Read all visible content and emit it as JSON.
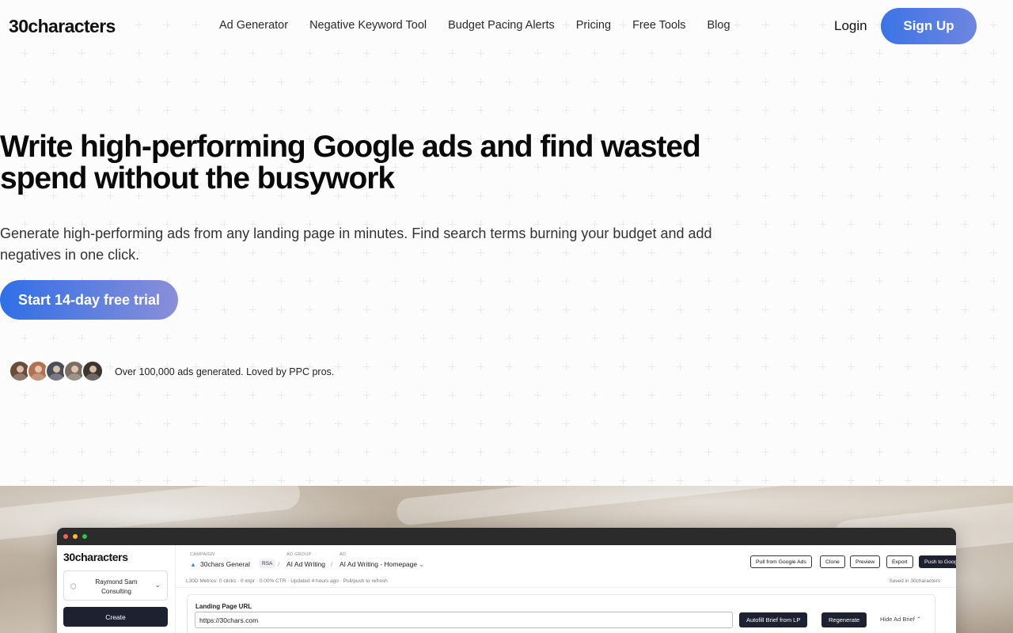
{
  "header": {
    "logo": "30characters",
    "nav": [
      "Ad Generator",
      "Negative Keyword Tool",
      "Budget Pacing Alerts",
      "Pricing",
      "Free Tools",
      "Blog"
    ],
    "login": "Login",
    "signup": "Sign Up"
  },
  "hero": {
    "title": "Write high-performing Google ads and find wasted spend without the busywork",
    "subtitle": "Generate high-performing ads from any landing page in minutes. Find search terms burning your budget and add negatives in one click.",
    "cta": "Start 14-day free trial",
    "social_proof": "Over 100,000 ads generated. Loved by PPC pros."
  },
  "avatars": [
    {
      "color": "#6b4b3a"
    },
    {
      "color": "#b07252"
    },
    {
      "color": "#4a4f57"
    },
    {
      "color": "#7b6f64"
    },
    {
      "color": "#3d3530"
    }
  ],
  "app": {
    "logo": "30characters",
    "org": "Raymond Sam Consulting",
    "create": "Create",
    "breadcrumb": {
      "campaign_label": "CAMPAIGN",
      "campaign": "30chars General",
      "badge": "RSA",
      "adgroup_label": "AD GROUP",
      "adgroup": "AI Ad Writing",
      "ad_label": "AD",
      "ad": "AI Ad Writing - Homepage"
    },
    "toolbar": {
      "pull": "Pull from Google Ads",
      "clone": "Clone",
      "preview": "Preview",
      "export": "Export",
      "push": "Push to Google Ads"
    },
    "metrics": "L30D Metrics: 0 clicks  ·  0 impr  ·  0.00% CTR  ·  Updated 4 hours ago  ·  Pull/push to refresh",
    "saved": "Saved in 30characters",
    "brief": {
      "label": "Landing Page URL",
      "url": "https://30chars.com",
      "autofill": "Autofill Brief from LP",
      "regenerate": "Regenerate",
      "hide": "Hide Ad Brief"
    }
  },
  "colors": {
    "accent_start": "#3b74e6",
    "accent_end": "#6e86e0",
    "dark_button": "#1e2230"
  }
}
